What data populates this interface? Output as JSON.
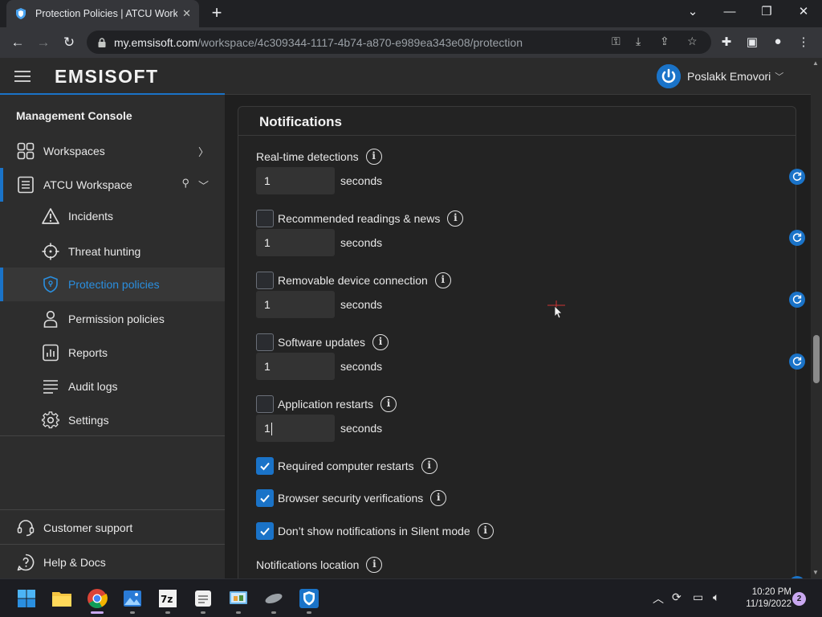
{
  "browser": {
    "tab_title": "Protection Policies | ATCU Worksp",
    "url_host": "my.emsisoft.com",
    "url_path": "/workspace/4c309344-1117-4b74-a870-e989ea343e08/protection"
  },
  "header": {
    "logo": "EMSISOFT",
    "user_name": "Poslakk Emovori"
  },
  "sidebar": {
    "title": "Management Console",
    "workspaces_label": "Workspaces",
    "workspace_label": "ATCU Workspace",
    "items": [
      {
        "label": "Incidents",
        "icon": "warning-icon"
      },
      {
        "label": "Threat hunting",
        "icon": "crosshair-icon"
      },
      {
        "label": "Protection policies",
        "icon": "shield-icon"
      },
      {
        "label": "Permission policies",
        "icon": "user-icon"
      },
      {
        "label": "Reports",
        "icon": "report-icon"
      },
      {
        "label": "Audit logs",
        "icon": "list-icon"
      },
      {
        "label": "Settings",
        "icon": "gear-icon"
      }
    ],
    "support_label": "Customer support",
    "help_label": "Help & Docs"
  },
  "panel": {
    "title": "Notifications",
    "seconds_label": "seconds",
    "realtime_label": "Real-time detections",
    "realtime_value": "1",
    "timed_rows": [
      {
        "label": "Recommended readings & news",
        "checked": false,
        "value": "1"
      },
      {
        "label": "Removable device connection",
        "checked": false,
        "value": "1"
      },
      {
        "label": "Software updates",
        "checked": false,
        "value": "1"
      },
      {
        "label": "Application restarts",
        "checked": false,
        "value": "1"
      }
    ],
    "check_rows": [
      {
        "label": "Required computer restarts",
        "checked": true
      },
      {
        "label": "Browser security verifications",
        "checked": true
      },
      {
        "label": "Don’t show notifications in Silent mode",
        "checked": true
      }
    ],
    "location_label": "Notifications location"
  },
  "taskbar": {
    "time": "10:20 PM",
    "date": "11/19/2022",
    "notification_count": "2"
  },
  "colors": {
    "accent": "#1a73c8",
    "active_text": "#2a8fe0",
    "sidebar_bg": "#2d2d2d",
    "main_bg": "#1f1f1f"
  }
}
